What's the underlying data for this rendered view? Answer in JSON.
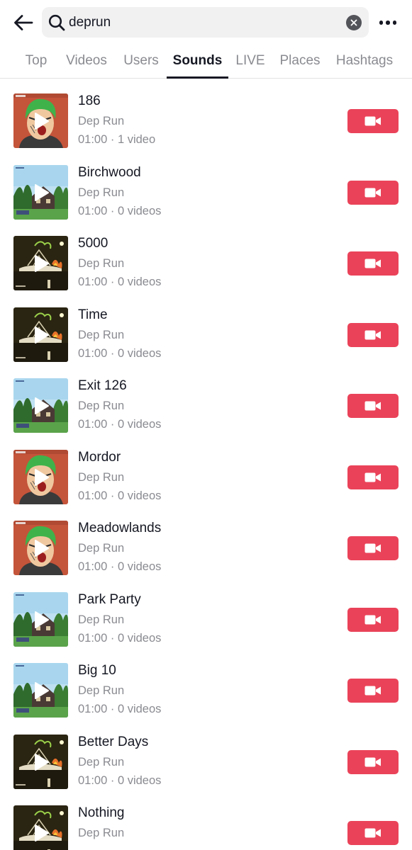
{
  "header": {
    "back_icon": "arrow-left-icon",
    "search_icon": "search-icon",
    "query": "deprun",
    "clear_icon": "clear-x-icon",
    "more_icon": "more-dots-icon"
  },
  "tabs": [
    {
      "label": "Top"
    },
    {
      "label": "Videos"
    },
    {
      "label": "Users"
    },
    {
      "label": "Sounds",
      "active": true
    },
    {
      "label": "LIVE"
    },
    {
      "label": "Places"
    },
    {
      "label": "Hashtags"
    }
  ],
  "colors": {
    "accent": "#ea4359",
    "secondary_text": "#8a8b91",
    "primary_text": "#161823",
    "search_bg": "#f1f1f2"
  },
  "sounds": [
    {
      "title": "186",
      "artist": "Dep Run",
      "meta": "01:00 · 1 video",
      "art": "portrait"
    },
    {
      "title": "Birchwood",
      "artist": "Dep Run",
      "meta": "01:00 · 0 videos",
      "art": "house"
    },
    {
      "title": "5000",
      "artist": "Dep Run",
      "meta": "01:00 · 0 videos",
      "art": "night"
    },
    {
      "title": "Time",
      "artist": "Dep Run",
      "meta": "01:00 · 0 videos",
      "art": "night"
    },
    {
      "title": "Exit 126",
      "artist": "Dep Run",
      "meta": "01:00 · 0 videos",
      "art": "house"
    },
    {
      "title": "Mordor",
      "artist": "Dep Run",
      "meta": "01:00 · 0 videos",
      "art": "portrait"
    },
    {
      "title": "Meadowlands",
      "artist": "Dep Run",
      "meta": "01:00 · 0 videos",
      "art": "portrait"
    },
    {
      "title": "Park Party",
      "artist": "Dep Run",
      "meta": "01:00 · 0 videos",
      "art": "house"
    },
    {
      "title": "Big 10",
      "artist": "Dep Run",
      "meta": "01:00 · 0 videos",
      "art": "house"
    },
    {
      "title": "Better Days",
      "artist": "Dep Run",
      "meta": "01:00 · 0 videos",
      "art": "night"
    },
    {
      "title": "Nothing",
      "artist": "Dep Run",
      "meta": "",
      "art": "night"
    }
  ],
  "row_action_icon": "video-camera-icon",
  "thumbnail_overlay_icon": "play-icon"
}
